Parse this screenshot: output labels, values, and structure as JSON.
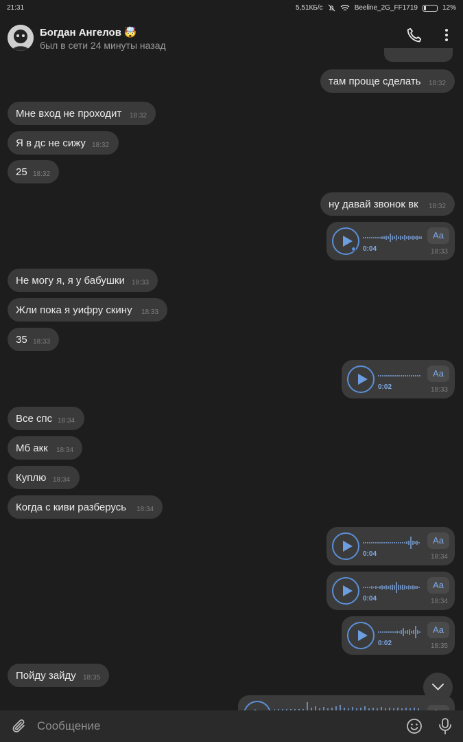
{
  "status": {
    "time": "21:31",
    "speed": "5,51КБ/с",
    "network": "Beeline_2G_FF1719",
    "battery": "12%",
    "battery_level": 0.12
  },
  "header": {
    "name": "Богдан Ангелов",
    "name_emoji": "🤯",
    "seen": "был в сети 24 минуты назад"
  },
  "messages": {
    "m1": {
      "text": "там проще сделать",
      "time": "18:32"
    },
    "m2": {
      "text": "Мне вход не проходит",
      "time": "18:32"
    },
    "m3": {
      "text": "Я в дс не сижу",
      "time": "18:32"
    },
    "m4": {
      "text": "25",
      "time": "18:32"
    },
    "m5": {
      "text": "ну давай звонок вк",
      "time": "18:32"
    },
    "v1": {
      "duration": "0:04",
      "time": "18:33",
      "transcribe": "Aa"
    },
    "m6": {
      "text": "Не могу я, я у бабушки",
      "time": "18:33"
    },
    "m7": {
      "text": "Жли пока я уифру скину",
      "time": "18:33"
    },
    "m8": {
      "text": "35",
      "time": "18:33"
    },
    "v2": {
      "duration": "0:02",
      "time": "18:33",
      "transcribe": "Aa"
    },
    "m9": {
      "text": "Все спс",
      "time": "18:34"
    },
    "m10": {
      "text": "Мб акк",
      "time": "18:34"
    },
    "m11": {
      "text": "Куплю",
      "time": "18:34"
    },
    "m12": {
      "text": "Когда с киви разберусь",
      "time": "18:34"
    },
    "v3": {
      "duration": "0:04",
      "time": "18:34",
      "transcribe": "Aa"
    },
    "v4": {
      "duration": "0:04",
      "time": "18:34",
      "transcribe": "Aa"
    },
    "v5": {
      "duration": "0:02",
      "time": "18:35",
      "transcribe": "Aa"
    },
    "m13": {
      "text": "Пойду зайду",
      "time": "18:35"
    },
    "v6": {
      "transcribe": "Aa"
    }
  },
  "composer": {
    "placeholder": "Сообщение"
  },
  "colors": {
    "accent": "#5b8fd6",
    "bubble": "#3a3a3a",
    "background": "#1d1d1d"
  },
  "icons": [
    "phone-icon",
    "more-icon",
    "chevron-down-icon",
    "attach-icon",
    "emoji-icon",
    "mic-icon",
    "play-icon"
  ]
}
